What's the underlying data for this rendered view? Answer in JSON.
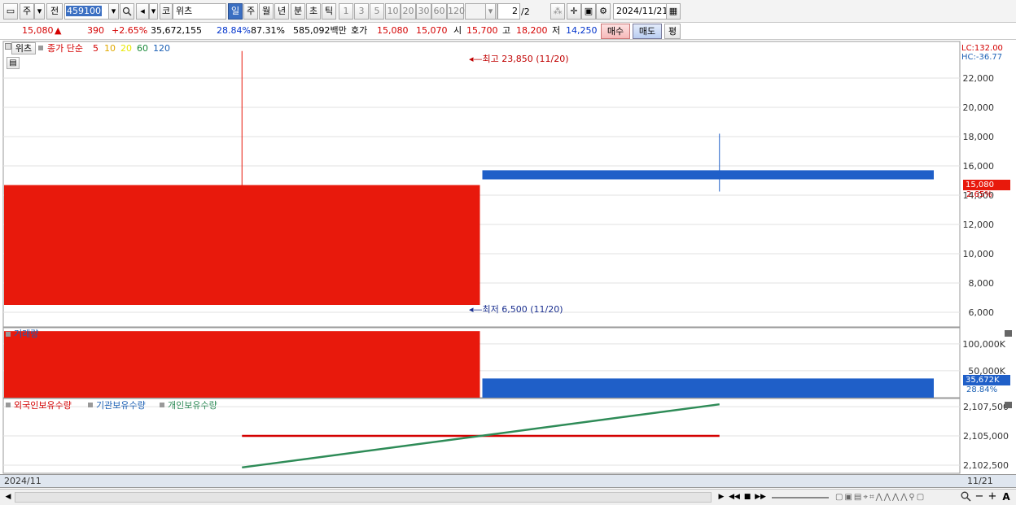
{
  "toolbar": {
    "period_weekly": "주",
    "prev_label": "전",
    "code": "459100",
    "exchange_tag": "코",
    "stock_name": "위츠",
    "periods": [
      "일",
      "주",
      "월",
      "년",
      "분",
      "초",
      "틱"
    ],
    "active_period": "일",
    "intervals": [
      "1",
      "3",
      "5",
      "10",
      "20",
      "30",
      "60",
      "120"
    ],
    "page_current": "2",
    "page_total": "/2",
    "date": "2024/11/21"
  },
  "quote": {
    "price": "15,080",
    "arrow": "▲",
    "change": "390",
    "change_pct": "+2.65%",
    "volume": "35,672,155",
    "vol_ratio": "28.84%",
    "ratio2": "87.31%",
    "amount": "585,092백만",
    "hoga_label": "호가",
    "ask": "15,080",
    "bid": "15,070",
    "open_label": "시",
    "open": "15,700",
    "high_label": "고",
    "high": "18,200",
    "low_label": "저",
    "low": "14,250",
    "buy_label": "매수",
    "sell_label": "매도",
    "avg_label": "평"
  },
  "price_pane": {
    "legend_name": "위츠",
    "legend_ma": "종가 단순",
    "ma_periods": [
      "5",
      "10",
      "20",
      "60",
      "120"
    ],
    "ma_colors": [
      "#d40000",
      "#e0a800",
      "#e8e800",
      "#1a8a3a",
      "#1a5fb4"
    ],
    "lc": "LC:132.00",
    "hc": "HC:-36.77",
    "high_note": "최고 23,850 (11/20)",
    "low_note": "최저 6,500 (11/20)",
    "current_tag": "15,080",
    "current_pct": "2.65%",
    "ticks": [
      "22,000",
      "20,000",
      "18,000",
      "16,000",
      "14,000",
      "12,000",
      "10,000",
      "8,000",
      "6,000"
    ]
  },
  "volume_pane": {
    "title": "거래량",
    "ticks": [
      "100,000K",
      "50,000K"
    ],
    "current_tag": "35,672K",
    "current_pct": "28.84%"
  },
  "holding_pane": {
    "legend": [
      "외국인보유수량",
      "기관보유수량",
      "개인보유수량"
    ],
    "legend_colors": [
      "#d40000",
      "#1a5fb4",
      "#2e8b57"
    ],
    "ticks": [
      "2,107,500",
      "2,105,000",
      "2,102,500"
    ]
  },
  "footer": {
    "start_date": "2024/11",
    "end_date": "11/21"
  },
  "colors": {
    "up": "#e8190c",
    "down": "#1f5fc8",
    "foreign": "#d40000",
    "individual": "#2e8b57"
  },
  "chart_data": [
    {
      "type": "candlestick",
      "categories": [
        "11/20",
        "11/21"
      ],
      "series": [
        {
          "name": "위츠",
          "open": [
            6500,
            15700
          ],
          "high": [
            23850,
            18200
          ],
          "low": [
            6500,
            14250
          ],
          "close": [
            14690,
            15080
          ]
        }
      ],
      "ylim": [
        5000,
        24500
      ]
    },
    {
      "type": "bar",
      "title": "거래량",
      "categories": [
        "11/20",
        "11/21"
      ],
      "values": [
        123700,
        35672
      ],
      "ylim": [
        0,
        130000
      ]
    },
    {
      "type": "line",
      "categories": [
        "11/20",
        "11/21"
      ],
      "series": [
        {
          "name": "외국인보유수량",
          "values": [
            2105000,
            2105000
          ]
        },
        {
          "name": "개인보유수량",
          "values": [
            2102300,
            2107700
          ]
        }
      ],
      "ylim": [
        2101800,
        2108200
      ]
    }
  ]
}
